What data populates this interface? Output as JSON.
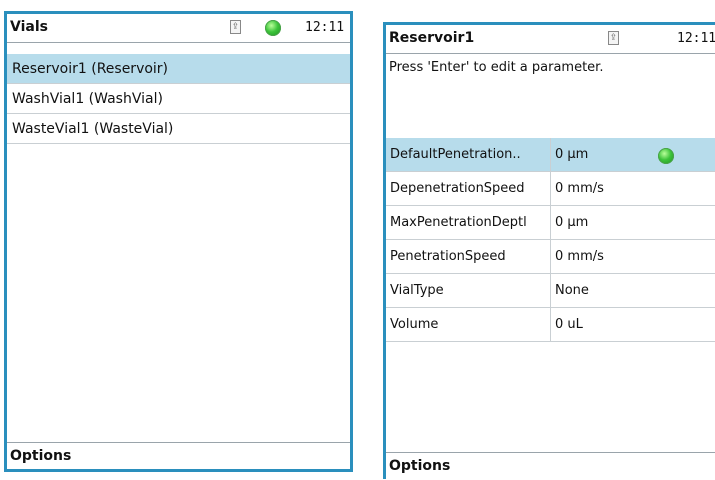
{
  "vials_screen": {
    "title": "Vials",
    "time": "12:11",
    "usb_icon": "usb-icon",
    "status_led_color": "#3cc33a",
    "items": [
      {
        "label": "Reservoir1 (Reservoir)",
        "selected": true
      },
      {
        "label": "WashVial1 (WashVial)",
        "selected": false
      },
      {
        "label": "WasteVial1 (WasteVial)",
        "selected": false
      }
    ],
    "options_label": "Options"
  },
  "reservoir_screen": {
    "title": "Reservoir1",
    "time": "12:11",
    "usb_icon": "usb-icon",
    "hint": "Press 'Enter' to edit a parameter.",
    "params": [
      {
        "name": "DefaultPenetration..",
        "value": "0 µm"
      },
      {
        "name": "DepenetrationSpeed",
        "value": "0 mm/s"
      },
      {
        "name": "MaxPenetrationDeptl",
        "value": "0 µm"
      },
      {
        "name": "PenetrationSpeed",
        "value": "0 mm/s"
      },
      {
        "name": "VialType",
        "value": "None"
      },
      {
        "name": "Volume",
        "value": "0 uL"
      }
    ],
    "options_label": "Options"
  },
  "colors": {
    "frame": "#2a8fbd",
    "selection": "#b7dceb"
  }
}
